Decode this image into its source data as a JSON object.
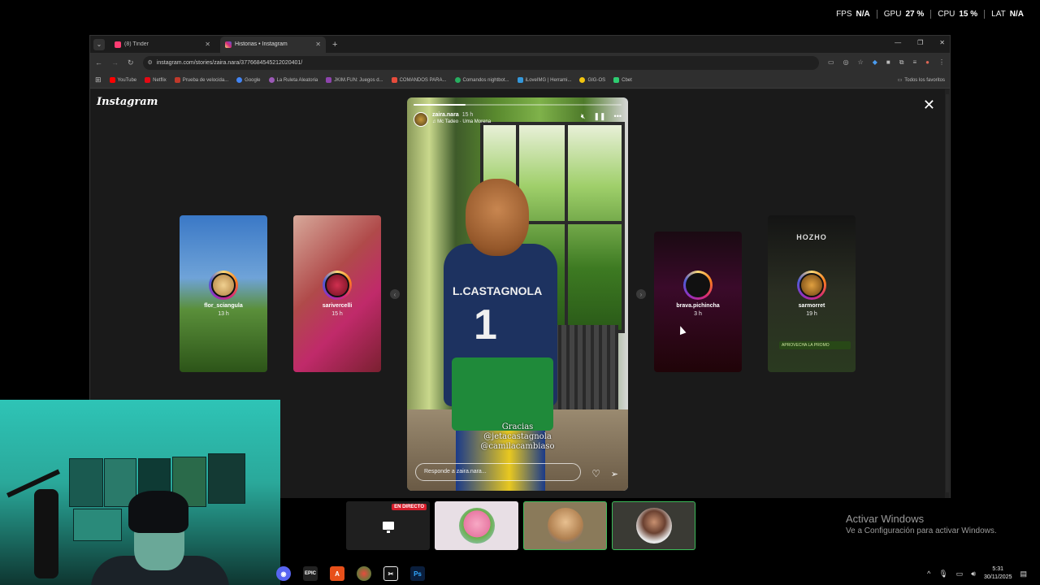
{
  "perf": {
    "fps_label": "FPS",
    "fps_value": "N/A",
    "gpu_label": "GPU",
    "gpu_value": "27 %",
    "cpu_label": "CPU",
    "cpu_value": "15 %",
    "lat_label": "LAT",
    "lat_value": "N/A"
  },
  "browser": {
    "tabs": [
      {
        "title": "(8) Tinder",
        "color": "#fe3c72"
      },
      {
        "title": "Historias • Instagram",
        "color": "#d62976"
      }
    ],
    "url": "instagram.com/stories/zaira.nara/3776684545212020401/",
    "bookmarks": [
      {
        "label": "YouTube",
        "color": "#ff0000"
      },
      {
        "label": "Netflix",
        "color": "#e50914"
      },
      {
        "label": "Prueba de velocida...",
        "color": "#c0392b"
      },
      {
        "label": "Google",
        "color": "#4285f4"
      },
      {
        "label": "La Ruleta Aleatoria",
        "color": "#9b59b6"
      },
      {
        "label": "JKIM.FUN: Juegos d...",
        "color": "#8e44ad"
      },
      {
        "label": "COMANDOS PARA...",
        "color": "#e74c3c"
      },
      {
        "label": "Comandos nightbot...",
        "color": "#27ae60"
      },
      {
        "label": "iLoveIMG | Herrami...",
        "color": "#3498db"
      },
      {
        "label": "GIG-OS",
        "color": "#f1c40f"
      },
      {
        "label": "Cbet",
        "color": "#2ecc71"
      }
    ],
    "all_bookmarks": "Todos los favoritos"
  },
  "instagram": {
    "logo": "Instagram",
    "side_stories": [
      {
        "name": "flor_sciangula",
        "time": "13 h"
      },
      {
        "name": "sarivercelli",
        "time": "15 h"
      },
      {
        "name": "brava.pichincha",
        "time": "3 h"
      },
      {
        "name": "sarmorret",
        "time": "19 h",
        "header": "HOZHO",
        "promo": "APROVECHA LA PROMO"
      }
    ],
    "main_story": {
      "user": "zaira.nara",
      "time": "15 h",
      "song": "Mc Tadeo · Uma Morena",
      "progress": 0.25,
      "jersey_name": "L.CASTAGNOLA",
      "jersey_number": "1",
      "caption_line1": "Gracias",
      "caption_line2": "@jetacastagnola",
      "caption_line3": "@camilacambiaso",
      "reply_placeholder": "Responde a zaira.nara..."
    }
  },
  "call": {
    "live_label": "EN DIRECTO"
  },
  "activate": {
    "title": "Activar Windows",
    "subtitle": "Ve a Configuración para activar Windows."
  },
  "clock": {
    "time": "5:31",
    "date": "30/11/2025"
  }
}
